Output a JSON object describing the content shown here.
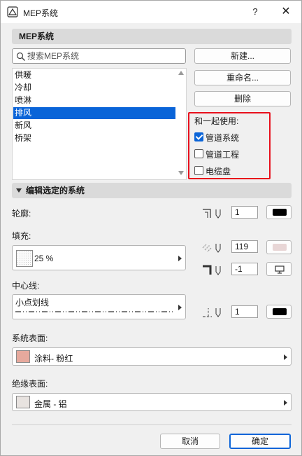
{
  "window": {
    "title": "MEP系统",
    "help_label": "?",
    "close_label": "✕"
  },
  "top_section": {
    "title": "MEP系统"
  },
  "search": {
    "placeholder": "搜索MEP系统"
  },
  "systems": {
    "items": [
      "供暖",
      "冷却",
      "喷淋",
      "排风",
      "新风",
      "桥架"
    ],
    "selected": "排风"
  },
  "buttons": {
    "new": "新建...",
    "rename": "重命名...",
    "delete": "删除"
  },
  "use_with": {
    "label": "和一起使用:",
    "options": [
      {
        "label": "管道系统",
        "checked": true
      },
      {
        "label": "管道工程",
        "checked": false
      },
      {
        "label": "电缆盘",
        "checked": false
      }
    ]
  },
  "edit_section": {
    "title": "编辑选定的系统"
  },
  "contour": {
    "label": "轮廓:",
    "pen_value": "1",
    "pen_color": "#000000"
  },
  "fill": {
    "label": "填充:",
    "value": "25 %",
    "fg_pen_value": "119",
    "fg_pen_color": "#e8d6d6",
    "bg_pen_value": "-1"
  },
  "centerline": {
    "label": "中心线:",
    "value": "小点划线",
    "pen_value": "1",
    "pen_color": "#000000"
  },
  "system_surface": {
    "label": "系统表面:",
    "value": "涂料- 粉红",
    "swatch": "#e6a99d"
  },
  "insulation_surface": {
    "label": "绝缘表面:",
    "value": "金属 - 铝",
    "swatch": "#e8e3e0"
  },
  "footer": {
    "cancel": "取消",
    "ok": "确定"
  },
  "accent_color": "#0a64d8",
  "highlight_color": "#e8101c"
}
